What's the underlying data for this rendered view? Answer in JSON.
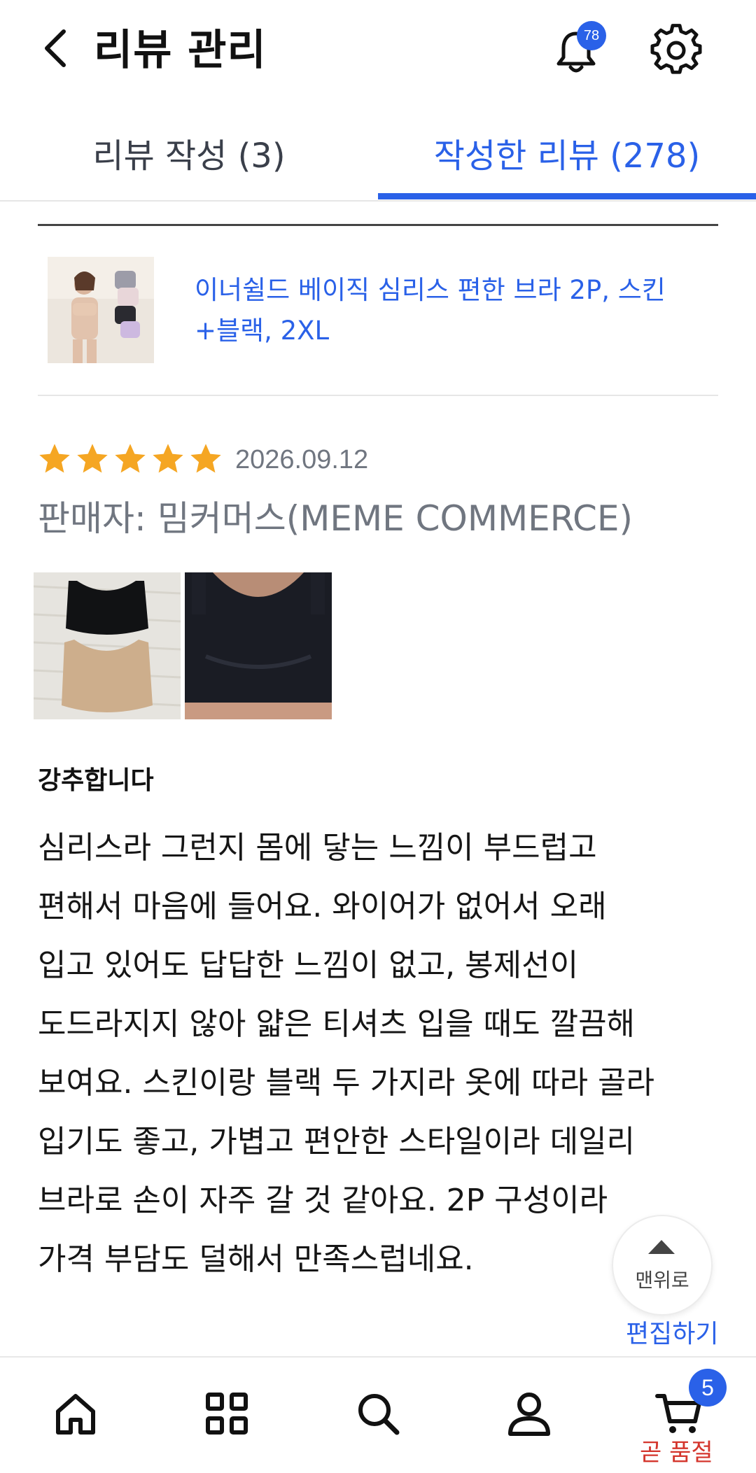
{
  "header": {
    "title": "리뷰 관리",
    "notification_count": "78"
  },
  "tabs": [
    {
      "label": "리뷰 작성 (3)"
    },
    {
      "label": "작성한 리뷰 (278)"
    }
  ],
  "product": {
    "name": "이너쉴드 베이직 심리스 편한 브라 2P, 스킨+블랙, 2XL"
  },
  "review": {
    "rating": 5,
    "date": "2026.09.12",
    "seller": "판매자: 밈커머스(MEME COMMERCE)",
    "headline": "강추합니다",
    "body": "심리스라 그런지 몸에 닿는 느낌이 부드럽고\n편해서 마음에 들어요. 와이어가 없어서 오래\n입고 있어도 답답한 느낌이 없고, 봉제선이\n도드라지지 않아 얇은 티셔츠 입을 때도 깔끔해\n보여요. 스킨이랑 블랙 두 가지라 옷에 따라 골라\n입기도 좋고, 가볍고 편안한 스타일이라 데일리\n브라로 손이 자주 갈 것 같아요. 2P 구성이라\n가격 부담도 덜해서 만족스럽네요."
  },
  "floating": {
    "top_label": "맨위로",
    "edit_label": "편집하기"
  },
  "bottom_nav": {
    "cart_count": "5",
    "cart_status": "곧 품절"
  },
  "colors": {
    "accent": "#2a61e8",
    "star": "#f5a623",
    "warning": "#d4352c"
  }
}
